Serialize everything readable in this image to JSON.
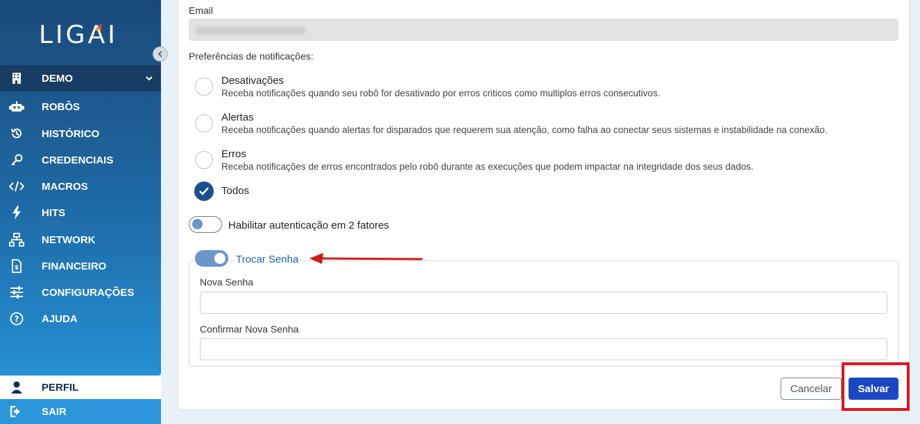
{
  "app": {
    "logo_text": "LIGAI"
  },
  "sidebar": {
    "org": "DEMO",
    "items": [
      {
        "label": "ROBÔS",
        "icon": "robot-icon"
      },
      {
        "label": "HISTÓRICO",
        "icon": "history-icon"
      },
      {
        "label": "CREDENCIAIS",
        "icon": "key-icon"
      },
      {
        "label": "MACROS",
        "icon": "code-icon"
      },
      {
        "label": "HITS",
        "icon": "bolt-icon"
      },
      {
        "label": "NETWORK",
        "icon": "network-icon"
      },
      {
        "label": "FINANCEIRO",
        "icon": "invoice-icon"
      },
      {
        "label": "CONFIGURAÇÕES",
        "icon": "sliders-icon"
      },
      {
        "label": "AJUDA",
        "icon": "help-icon"
      }
    ],
    "perfil": "PERFIL",
    "sair": "SAIR"
  },
  "form": {
    "email_label": "Email",
    "notif_label": "Preferências de notificações:",
    "options": [
      {
        "title": "Desativações",
        "desc": "Receba notificações quando seu robô for desativado por erros criticos como multiplos erros consecutivos.",
        "checked": false
      },
      {
        "title": "Alertas",
        "desc": "Receba notificações quando alertas for disparados que requerem sua atenção, como falha ao conectar seus sistemas e instabilidade na conexão.",
        "checked": false
      },
      {
        "title": "Erros",
        "desc": "Receba notificações de erros encontrados pelo robô durante as execuções que podem impactar na integridade dos seus dados.",
        "checked": false
      },
      {
        "title": "Todos",
        "desc": "",
        "checked": true
      }
    ],
    "twofa_label": "Habilitar autenticação em 2 fatores",
    "twofa_on": false,
    "change_pw_label": "Trocar Senha",
    "change_pw_on": true,
    "new_pw_label": "Nova Senha",
    "new_pw_value": "",
    "confirm_pw_label": "Confirmar Nova Senha",
    "confirm_pw_value": "",
    "cancel_label": "Cancelar",
    "save_label": "Salvar"
  },
  "colors": {
    "primary": "#1c47c2",
    "highlight": "#e0141a",
    "sidebar_top": "#1a4a78",
    "sidebar_bottom": "#2590d3"
  }
}
